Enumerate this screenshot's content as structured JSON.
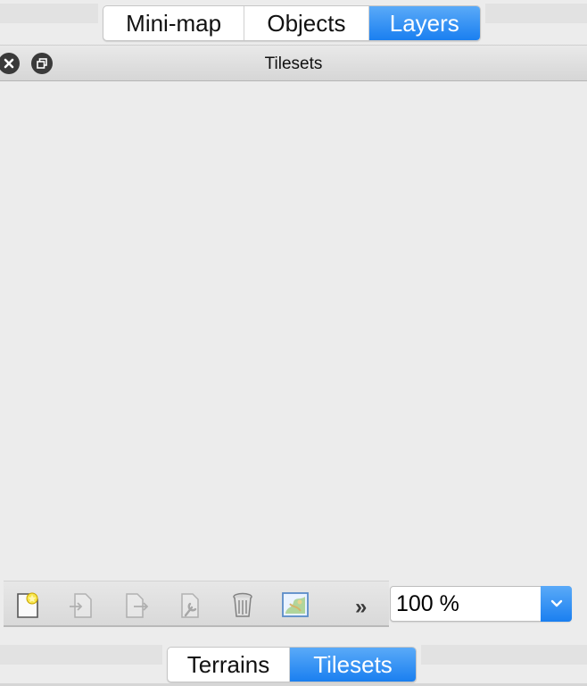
{
  "top_tabs": {
    "items": [
      {
        "label": "Mini-map",
        "active": false
      },
      {
        "label": "Objects",
        "active": false
      },
      {
        "label": "Layers",
        "active": true
      }
    ]
  },
  "panel": {
    "title": "Tilesets",
    "buttons": {
      "close_icon": "close-icon",
      "float_icon": "float-icon"
    }
  },
  "toolbar": {
    "tools": [
      {
        "name": "new-tileset",
        "icon": "new-document-star-icon"
      },
      {
        "name": "import-tileset",
        "icon": "import-icon"
      },
      {
        "name": "export-tileset",
        "icon": "export-icon"
      },
      {
        "name": "tileset-properties",
        "icon": "properties-wrench-icon"
      },
      {
        "name": "delete-tileset",
        "icon": "trash-icon"
      },
      {
        "name": "edit-tileset",
        "icon": "map-image-icon"
      }
    ],
    "more_label": "»"
  },
  "zoom": {
    "value": "100 %"
  },
  "bottom_tabs": {
    "items": [
      {
        "label": "Terrains",
        "active": false
      },
      {
        "label": "Tilesets",
        "active": true
      }
    ]
  },
  "colors": {
    "accent": "#1a7ff0",
    "background": "#ececec"
  }
}
